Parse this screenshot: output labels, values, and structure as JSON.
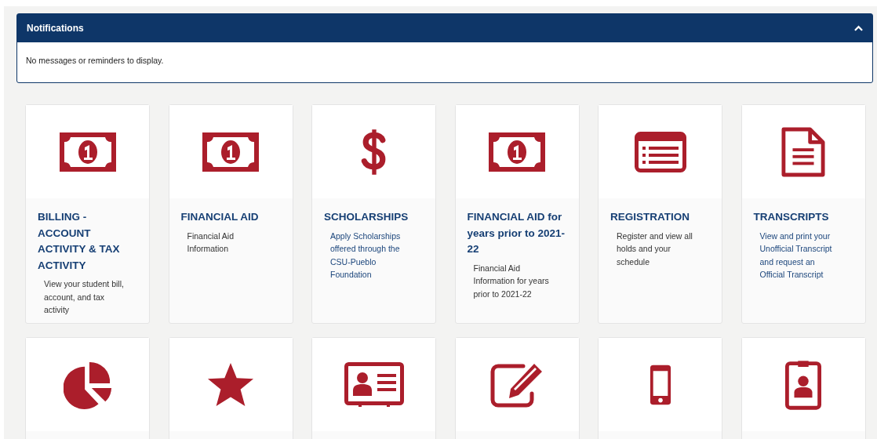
{
  "notifications": {
    "title": "Notifications",
    "expanded": true,
    "message": "No messages or reminders to display."
  },
  "cards": [
    {
      "kind": "bill",
      "title": "BILLING - ACCOUNT ACTIVITY & TAX ACTIVITY",
      "description": "View your student bill, account, and tax activity",
      "link": false
    },
    {
      "kind": "bill",
      "title": "FINANCIAL AID",
      "description": "Financial Aid Information",
      "link": false
    },
    {
      "kind": "dollar",
      "title": "SCHOLARSHIPS",
      "description": "Apply Scholarships offered through the CSU-Pueblo Foundation",
      "link": true
    },
    {
      "kind": "bill",
      "title": "FINANCIAL AID for years prior to 2021-22",
      "description": "Financial Aid Information for years prior to 2021-22",
      "link": false
    },
    {
      "kind": "list",
      "title": "REGISTRATION",
      "description": "Register and view all holds and your schedule",
      "link": false
    },
    {
      "kind": "document",
      "title": "TRANSCRIPTS",
      "description": "View and print your Unofficial Transcript and request an Official Transcript",
      "link": true
    },
    {
      "kind": "pie"
    },
    {
      "kind": "star"
    },
    {
      "kind": "idcard"
    },
    {
      "kind": "edit"
    },
    {
      "kind": "phone"
    },
    {
      "kind": "badge"
    }
  ]
}
